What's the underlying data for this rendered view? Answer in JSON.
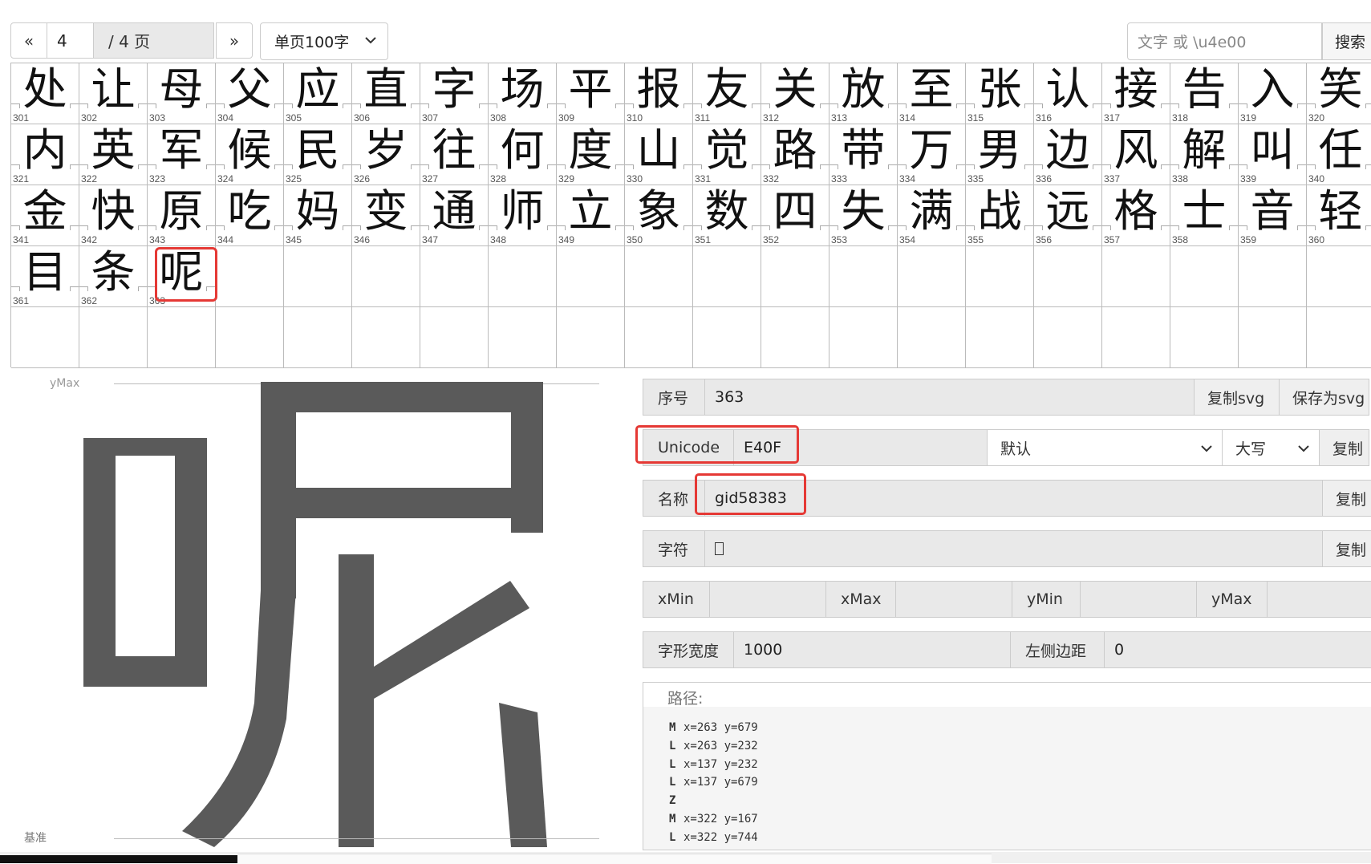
{
  "pager": {
    "prev": "«",
    "page": "4",
    "total": "/ 4 页",
    "next": "»",
    "per_page": "单页100字"
  },
  "search": {
    "placeholder": "文字 或 \\u4e00",
    "button": "搜索"
  },
  "glyphs": [
    {
      "c": "处",
      "n": "301"
    },
    {
      "c": "让",
      "n": "302"
    },
    {
      "c": "母",
      "n": "303"
    },
    {
      "c": "父",
      "n": "304"
    },
    {
      "c": "应",
      "n": "305"
    },
    {
      "c": "直",
      "n": "306"
    },
    {
      "c": "字",
      "n": "307"
    },
    {
      "c": "场",
      "n": "308"
    },
    {
      "c": "平",
      "n": "309"
    },
    {
      "c": "报",
      "n": "310"
    },
    {
      "c": "友",
      "n": "311"
    },
    {
      "c": "关",
      "n": "312"
    },
    {
      "c": "放",
      "n": "313"
    },
    {
      "c": "至",
      "n": "314"
    },
    {
      "c": "张",
      "n": "315"
    },
    {
      "c": "认",
      "n": "316"
    },
    {
      "c": "接",
      "n": "317"
    },
    {
      "c": "告",
      "n": "318"
    },
    {
      "c": "入",
      "n": "319"
    },
    {
      "c": "笑",
      "n": "320"
    },
    {
      "c": "内",
      "n": "321"
    },
    {
      "c": "英",
      "n": "322"
    },
    {
      "c": "军",
      "n": "323"
    },
    {
      "c": "候",
      "n": "324"
    },
    {
      "c": "民",
      "n": "325"
    },
    {
      "c": "岁",
      "n": "326"
    },
    {
      "c": "往",
      "n": "327"
    },
    {
      "c": "何",
      "n": "328"
    },
    {
      "c": "度",
      "n": "329"
    },
    {
      "c": "山",
      "n": "330"
    },
    {
      "c": "觉",
      "n": "331"
    },
    {
      "c": "路",
      "n": "332"
    },
    {
      "c": "带",
      "n": "333"
    },
    {
      "c": "万",
      "n": "334"
    },
    {
      "c": "男",
      "n": "335"
    },
    {
      "c": "边",
      "n": "336"
    },
    {
      "c": "风",
      "n": "337"
    },
    {
      "c": "解",
      "n": "338"
    },
    {
      "c": "叫",
      "n": "339"
    },
    {
      "c": "任",
      "n": "340"
    },
    {
      "c": "金",
      "n": "341"
    },
    {
      "c": "快",
      "n": "342"
    },
    {
      "c": "原",
      "n": "343"
    },
    {
      "c": "吃",
      "n": "344"
    },
    {
      "c": "妈",
      "n": "345"
    },
    {
      "c": "变",
      "n": "346"
    },
    {
      "c": "通",
      "n": "347"
    },
    {
      "c": "师",
      "n": "348"
    },
    {
      "c": "立",
      "n": "349"
    },
    {
      "c": "象",
      "n": "350"
    },
    {
      "c": "数",
      "n": "351"
    },
    {
      "c": "四",
      "n": "352"
    },
    {
      "c": "失",
      "n": "353"
    },
    {
      "c": "满",
      "n": "354"
    },
    {
      "c": "战",
      "n": "355"
    },
    {
      "c": "远",
      "n": "356"
    },
    {
      "c": "格",
      "n": "357"
    },
    {
      "c": "士",
      "n": "358"
    },
    {
      "c": "音",
      "n": "359"
    },
    {
      "c": "轻",
      "n": "360"
    },
    {
      "c": "目",
      "n": "361"
    },
    {
      "c": "条",
      "n": "362"
    },
    {
      "c": "呢",
      "n": "363"
    }
  ],
  "preview": {
    "ymax_label": "yMax",
    "base_label": "基准",
    "glyph_color": "#5a5a5a"
  },
  "detail": {
    "index_label": "序号",
    "index_value": "363",
    "copy_svg": "复制svg",
    "save_svg": "保存为svg",
    "unicode_label": "Unicode",
    "unicode_value": "E40F",
    "encoding_select": "默认",
    "case_select": "大写",
    "copy": "复制",
    "name_label": "名称",
    "name_value": "gid58383",
    "char_label": "字符",
    "char_value": "",
    "xmin_label": "xMin",
    "xmax_label": "xMax",
    "ymin_label": "yMin",
    "ymax_label": "yMax",
    "width_label": "字形宽度",
    "width_value": "1000",
    "lsb_label": "左侧边距",
    "lsb_value": "0",
    "path_label": "路径:"
  },
  "path": [
    {
      "cmd": "M",
      "args": "x=263 y=679"
    },
    {
      "cmd": "L",
      "args": "x=263 y=232"
    },
    {
      "cmd": "L",
      "args": "x=137 y=232"
    },
    {
      "cmd": "L",
      "args": "x=137 y=679"
    },
    {
      "cmd": "Z",
      "args": ""
    },
    {
      "cmd": "M",
      "args": "x=322 y=167"
    },
    {
      "cmd": "L",
      "args": "x=322 y=744"
    }
  ],
  "accent": "#e53935"
}
